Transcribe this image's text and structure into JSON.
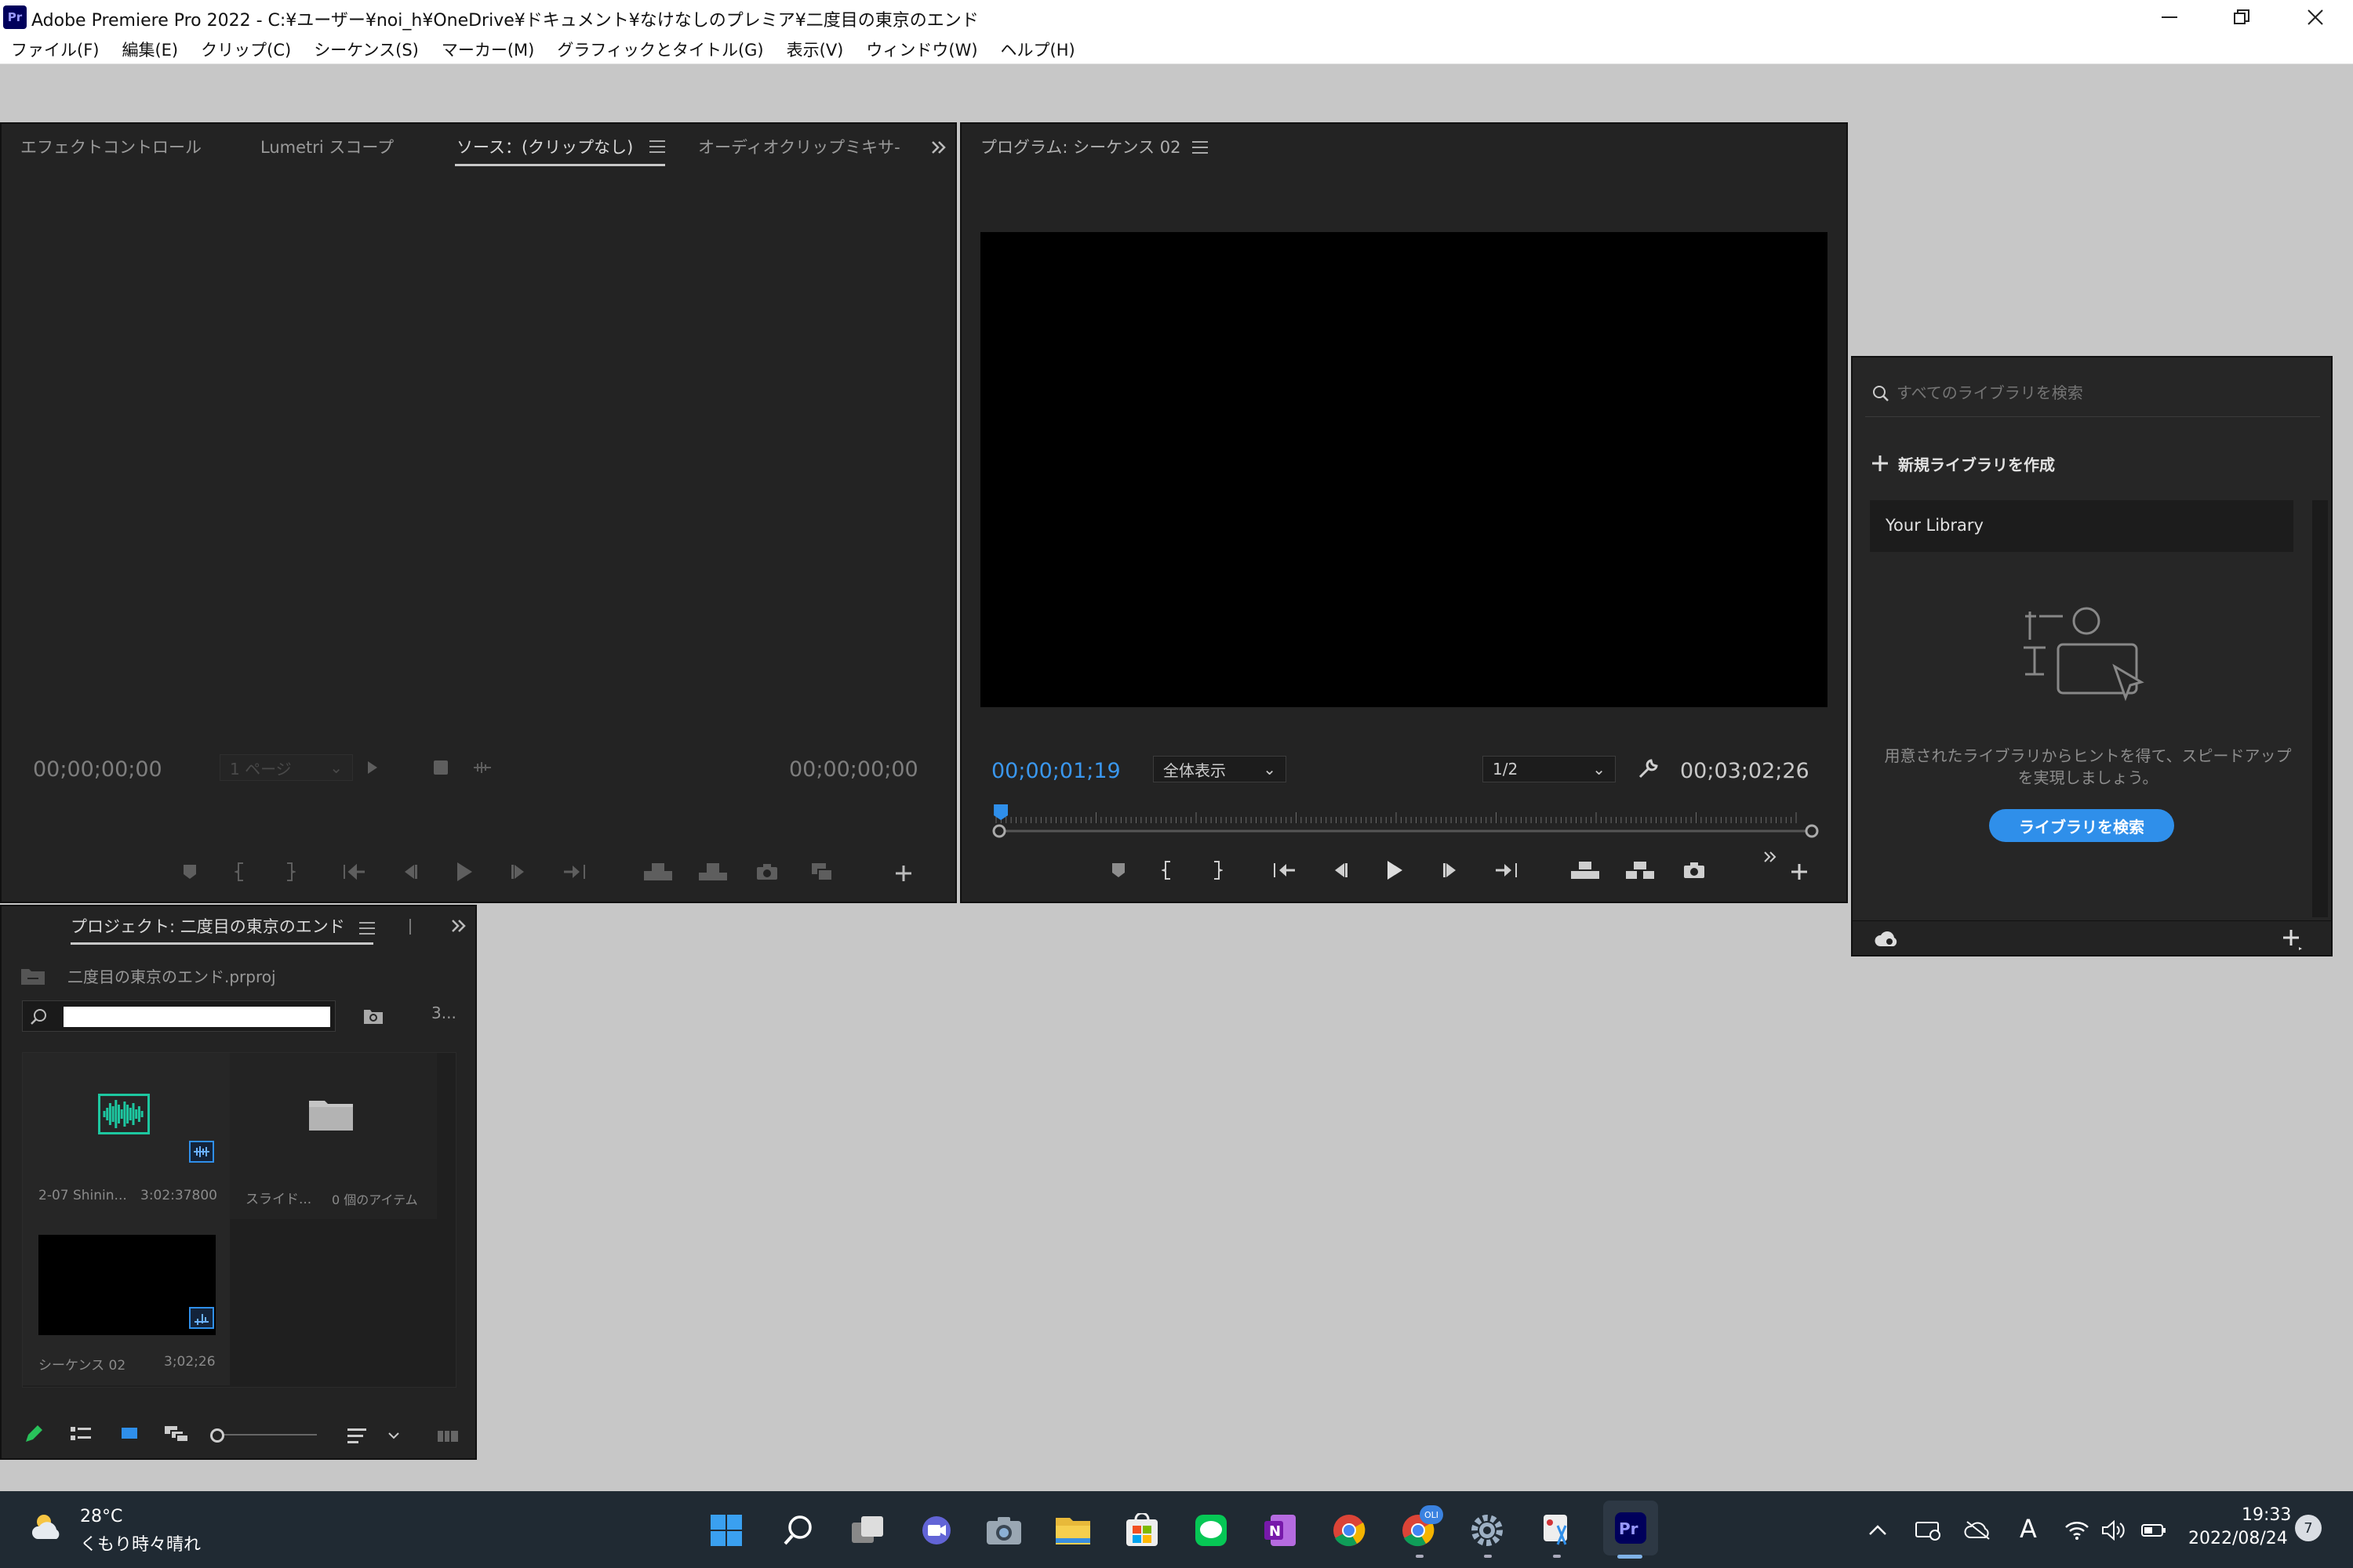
{
  "window": {
    "app_icon_label": "Pr",
    "title": "Adobe Premiere Pro 2022 - C:¥ユーザー¥noi_h¥OneDrive¥ドキュメント¥なけなしのプレミア¥二度目の東京のエンド"
  },
  "menu": [
    "ファイル(F)",
    "編集(E)",
    "クリップ(C)",
    "シーケンス(S)",
    "マーカー(M)",
    "グラフィックとタイトル(G)",
    "表示(V)",
    "ウィンドウ(W)",
    "ヘルプ(H)"
  ],
  "source_panel": {
    "tabs": [
      "エフェクトコントロール",
      "Lumetri スコープ",
      "ソース：(クリップなし)",
      "オーディオクリップミキサ-"
    ],
    "active_tab_index": 2,
    "timecode_left": "00;00;00;00",
    "page_select": "1 ページ",
    "timecode_right": "00;00;00;00"
  },
  "program_panel": {
    "title": "プログラム: シーケンス 02",
    "timecode": "00;00;01;19",
    "zoom": "全体表示",
    "resolution": "1/2",
    "duration": "00;03;02;26",
    "playhead_fraction": 0.005
  },
  "project_panel": {
    "title": "プロジェクト: 二度目の東京のエンド",
    "file": "二度目の東京のエンド.prproj",
    "search_value": "",
    "item_count": "3...",
    "items": [
      {
        "name": "2-07 Shinin...",
        "meta": "3:02:37800",
        "kind": "audio"
      },
      {
        "name": "スライド...",
        "meta": "0 個のアイテム",
        "kind": "bin"
      },
      {
        "name": "シーケンス 02",
        "meta": "3;02;26",
        "kind": "sequence"
      }
    ]
  },
  "libraries_panel": {
    "search_placeholder": "すべてのライブラリを検索",
    "create_label": "新規ライブラリを作成",
    "library_name": "Your Library",
    "hint": "用意されたライブラリからヒントを得て、スピードアップを実現しましょう。",
    "browse_button": "ライブラリを検索"
  },
  "taskbar": {
    "weather_temp": "28°C",
    "weather_desc": "くもり時々晴れ",
    "time": "19:33",
    "date": "2022/08/24",
    "notification_count": "7",
    "ime_label": "A",
    "onenote_label": "N",
    "pr_label": "Pr",
    "chrome_badge": "OLI"
  },
  "colors": {
    "accent_blue": "#2f8fea",
    "timecode_blue": "#3a97ee",
    "panel_bg": "#232323",
    "audio_green": "#1dc7a0"
  }
}
